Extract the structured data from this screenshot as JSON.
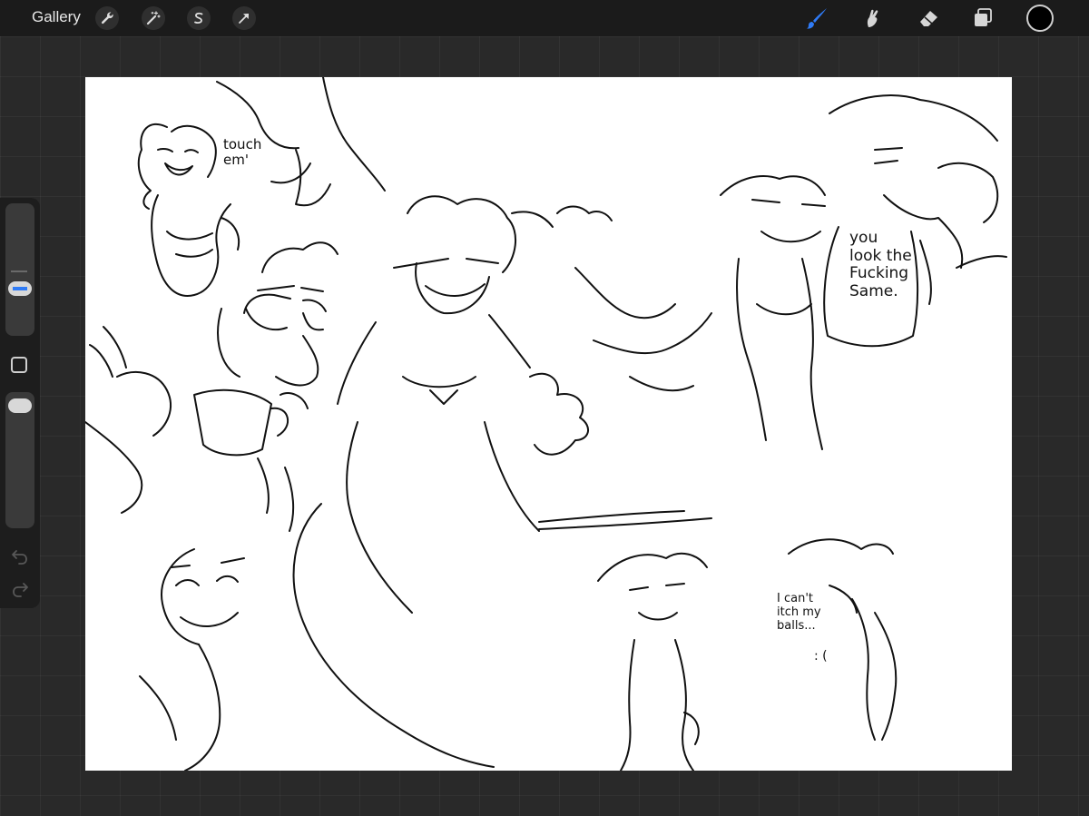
{
  "topbar": {
    "gallery_label": "Gallery",
    "left_tools": [
      {
        "name": "actions",
        "icon": "wrench-icon"
      },
      {
        "name": "adjustments",
        "icon": "magic-wand-icon"
      },
      {
        "name": "selection",
        "icon": "selection-s-icon"
      },
      {
        "name": "transform",
        "icon": "arrow-cursor-icon"
      }
    ],
    "right_tools": [
      {
        "name": "brush",
        "icon": "brush-icon",
        "active": true
      },
      {
        "name": "smudge",
        "icon": "smudge-icon",
        "active": false
      },
      {
        "name": "eraser",
        "icon": "eraser-icon",
        "active": false
      },
      {
        "name": "layers",
        "icon": "layers-icon",
        "active": false
      }
    ],
    "current_color": "#000000"
  },
  "sidebar": {
    "brush_size_level": 0.33,
    "opacity_level": 0.97,
    "accent_color": "#2f7bf6",
    "buttons": [
      "modify-square-icon",
      "undo-icon",
      "redo-icon"
    ]
  },
  "canvas": {
    "background": "#ffffff",
    "texts": {
      "touch": "touch\nem'",
      "same": "you\nlook the\nFucking\nSame.",
      "balls": "I can't\nitch my\nballs...",
      "frown": ": ("
    }
  }
}
